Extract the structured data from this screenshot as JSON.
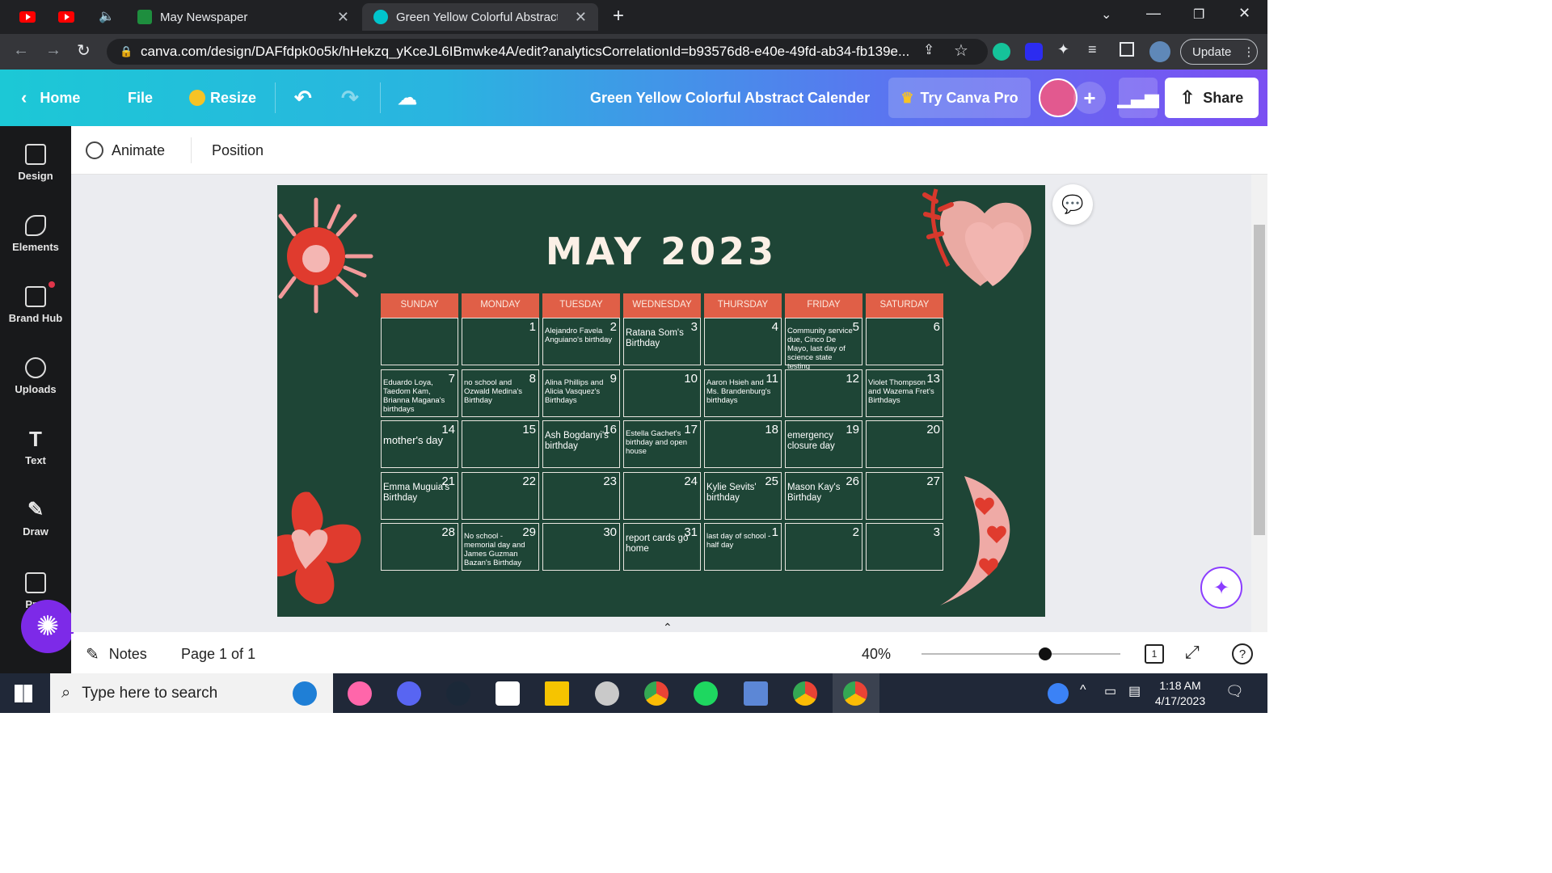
{
  "browser": {
    "tabs": [
      {
        "label": "May Newspaper"
      },
      {
        "label": "Green Yellow Colorful Abstract Ca"
      }
    ],
    "url": "canva.com/design/DAFfdpk0o5k/hHekzq_yKceJL6IBmwke4A/edit?analyticsCorrelationId=b93576d8-e40e-49fd-ab34-fb139e...",
    "update_label": "Update"
  },
  "header": {
    "home": "Home",
    "file": "File",
    "resize": "Resize",
    "doc_title": "Green Yellow Colorful Abstract Calender",
    "try_pro": "Try Canva Pro",
    "share": "Share"
  },
  "sidebar": {
    "items": [
      {
        "label": "Design"
      },
      {
        "label": "Elements"
      },
      {
        "label": "Brand Hub"
      },
      {
        "label": "Uploads"
      },
      {
        "label": "Text"
      },
      {
        "label": "Draw"
      },
      {
        "label": "Proj"
      }
    ]
  },
  "toolbar": {
    "animate": "Animate",
    "position": "Position"
  },
  "calendar": {
    "title": "MAY 2023",
    "days": [
      "SUNDAY",
      "MONDAY",
      "TUESDAY",
      "WEDNESDAY",
      "THURSDAY",
      "FRIDAY",
      "SATURDAY"
    ],
    "weeks": [
      [
        {
          "n": "",
          "t": ""
        },
        {
          "n": "1",
          "t": ""
        },
        {
          "n": "2",
          "t": "Alejandro Favela Anguiano's birthday"
        },
        {
          "n": "3",
          "t": "Ratana Som's Birthday"
        },
        {
          "n": "4",
          "t": ""
        },
        {
          "n": "5",
          "t": "Community service due, Cinco De Mayo, last day of science state testing"
        },
        {
          "n": "6",
          "t": ""
        }
      ],
      [
        {
          "n": "7",
          "t": "Eduardo Loya, Taedom Kam, Brianna Magana's birthdays"
        },
        {
          "n": "8",
          "t": "no school and Ozwald Medina's Birthday"
        },
        {
          "n": "9",
          "t": "Alina Phillips and Alicia Vasquez's Birthdays"
        },
        {
          "n": "10",
          "t": ""
        },
        {
          "n": "11",
          "t": "Aaron Hsieh and Ms. Brandenburg's birthdays"
        },
        {
          "n": "12",
          "t": ""
        },
        {
          "n": "13",
          "t": "Violet Thompson and Wazema Fret's Birthdays"
        }
      ],
      [
        {
          "n": "14",
          "t": "mother's day"
        },
        {
          "n": "15",
          "t": ""
        },
        {
          "n": "16",
          "t": "Ash Bogdanyi's birthday"
        },
        {
          "n": "17",
          "t": "Estella Gachet's birthday and open house"
        },
        {
          "n": "18",
          "t": ""
        },
        {
          "n": "19",
          "t": "emergency closure day"
        },
        {
          "n": "20",
          "t": ""
        }
      ],
      [
        {
          "n": "21",
          "t": "Emma Muguia's Birthday"
        },
        {
          "n": "22",
          "t": ""
        },
        {
          "n": "23",
          "t": ""
        },
        {
          "n": "24",
          "t": ""
        },
        {
          "n": "25",
          "t": "Kylie Sevits' birthday"
        },
        {
          "n": "26",
          "t": "Mason Kay's Birthday"
        },
        {
          "n": "27",
          "t": ""
        }
      ],
      [
        {
          "n": "28",
          "t": ""
        },
        {
          "n": "29",
          "t": "No school - memorial day and James Guzman Bazan's Birthday"
        },
        {
          "n": "30",
          "t": ""
        },
        {
          "n": "31",
          "t": "report cards go home"
        },
        {
          "n": "1",
          "t": "last day of school - half day"
        },
        {
          "n": "2",
          "t": ""
        },
        {
          "n": "3",
          "t": ""
        }
      ]
    ]
  },
  "bottom": {
    "notes": "Notes",
    "page": "Page 1 of 1",
    "zoom": "40%",
    "zoom_fraction": 0.62
  },
  "taskbar": {
    "search_placeholder": "Type here to search",
    "time": "1:18 AM",
    "date": "4/17/2023"
  }
}
